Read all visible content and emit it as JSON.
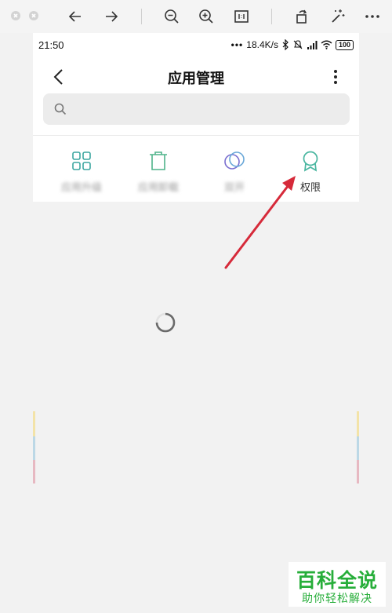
{
  "status_bar": {
    "time": "21:50",
    "network_speed": "18.4K/s",
    "battery": "100"
  },
  "header": {
    "title": "应用管理"
  },
  "search": {
    "placeholder": "",
    "value": ""
  },
  "functions": [
    {
      "label": "应用升级",
      "icon": "grid-icon",
      "color": "#3ca6a0"
    },
    {
      "label": "应用卸载",
      "icon": "trash-icon",
      "color": "#4fb38a"
    },
    {
      "label": "双开",
      "icon": "dual-circle-icon",
      "color": "#7b6fd0"
    },
    {
      "label": "权限",
      "icon": "badge-icon",
      "color": "#49b6a0"
    }
  ],
  "annotation": {
    "color": "#d62a3a"
  },
  "watermark": {
    "title": "百科全说",
    "subtitle": "助你轻松解决",
    "color": "#27ae3a"
  }
}
